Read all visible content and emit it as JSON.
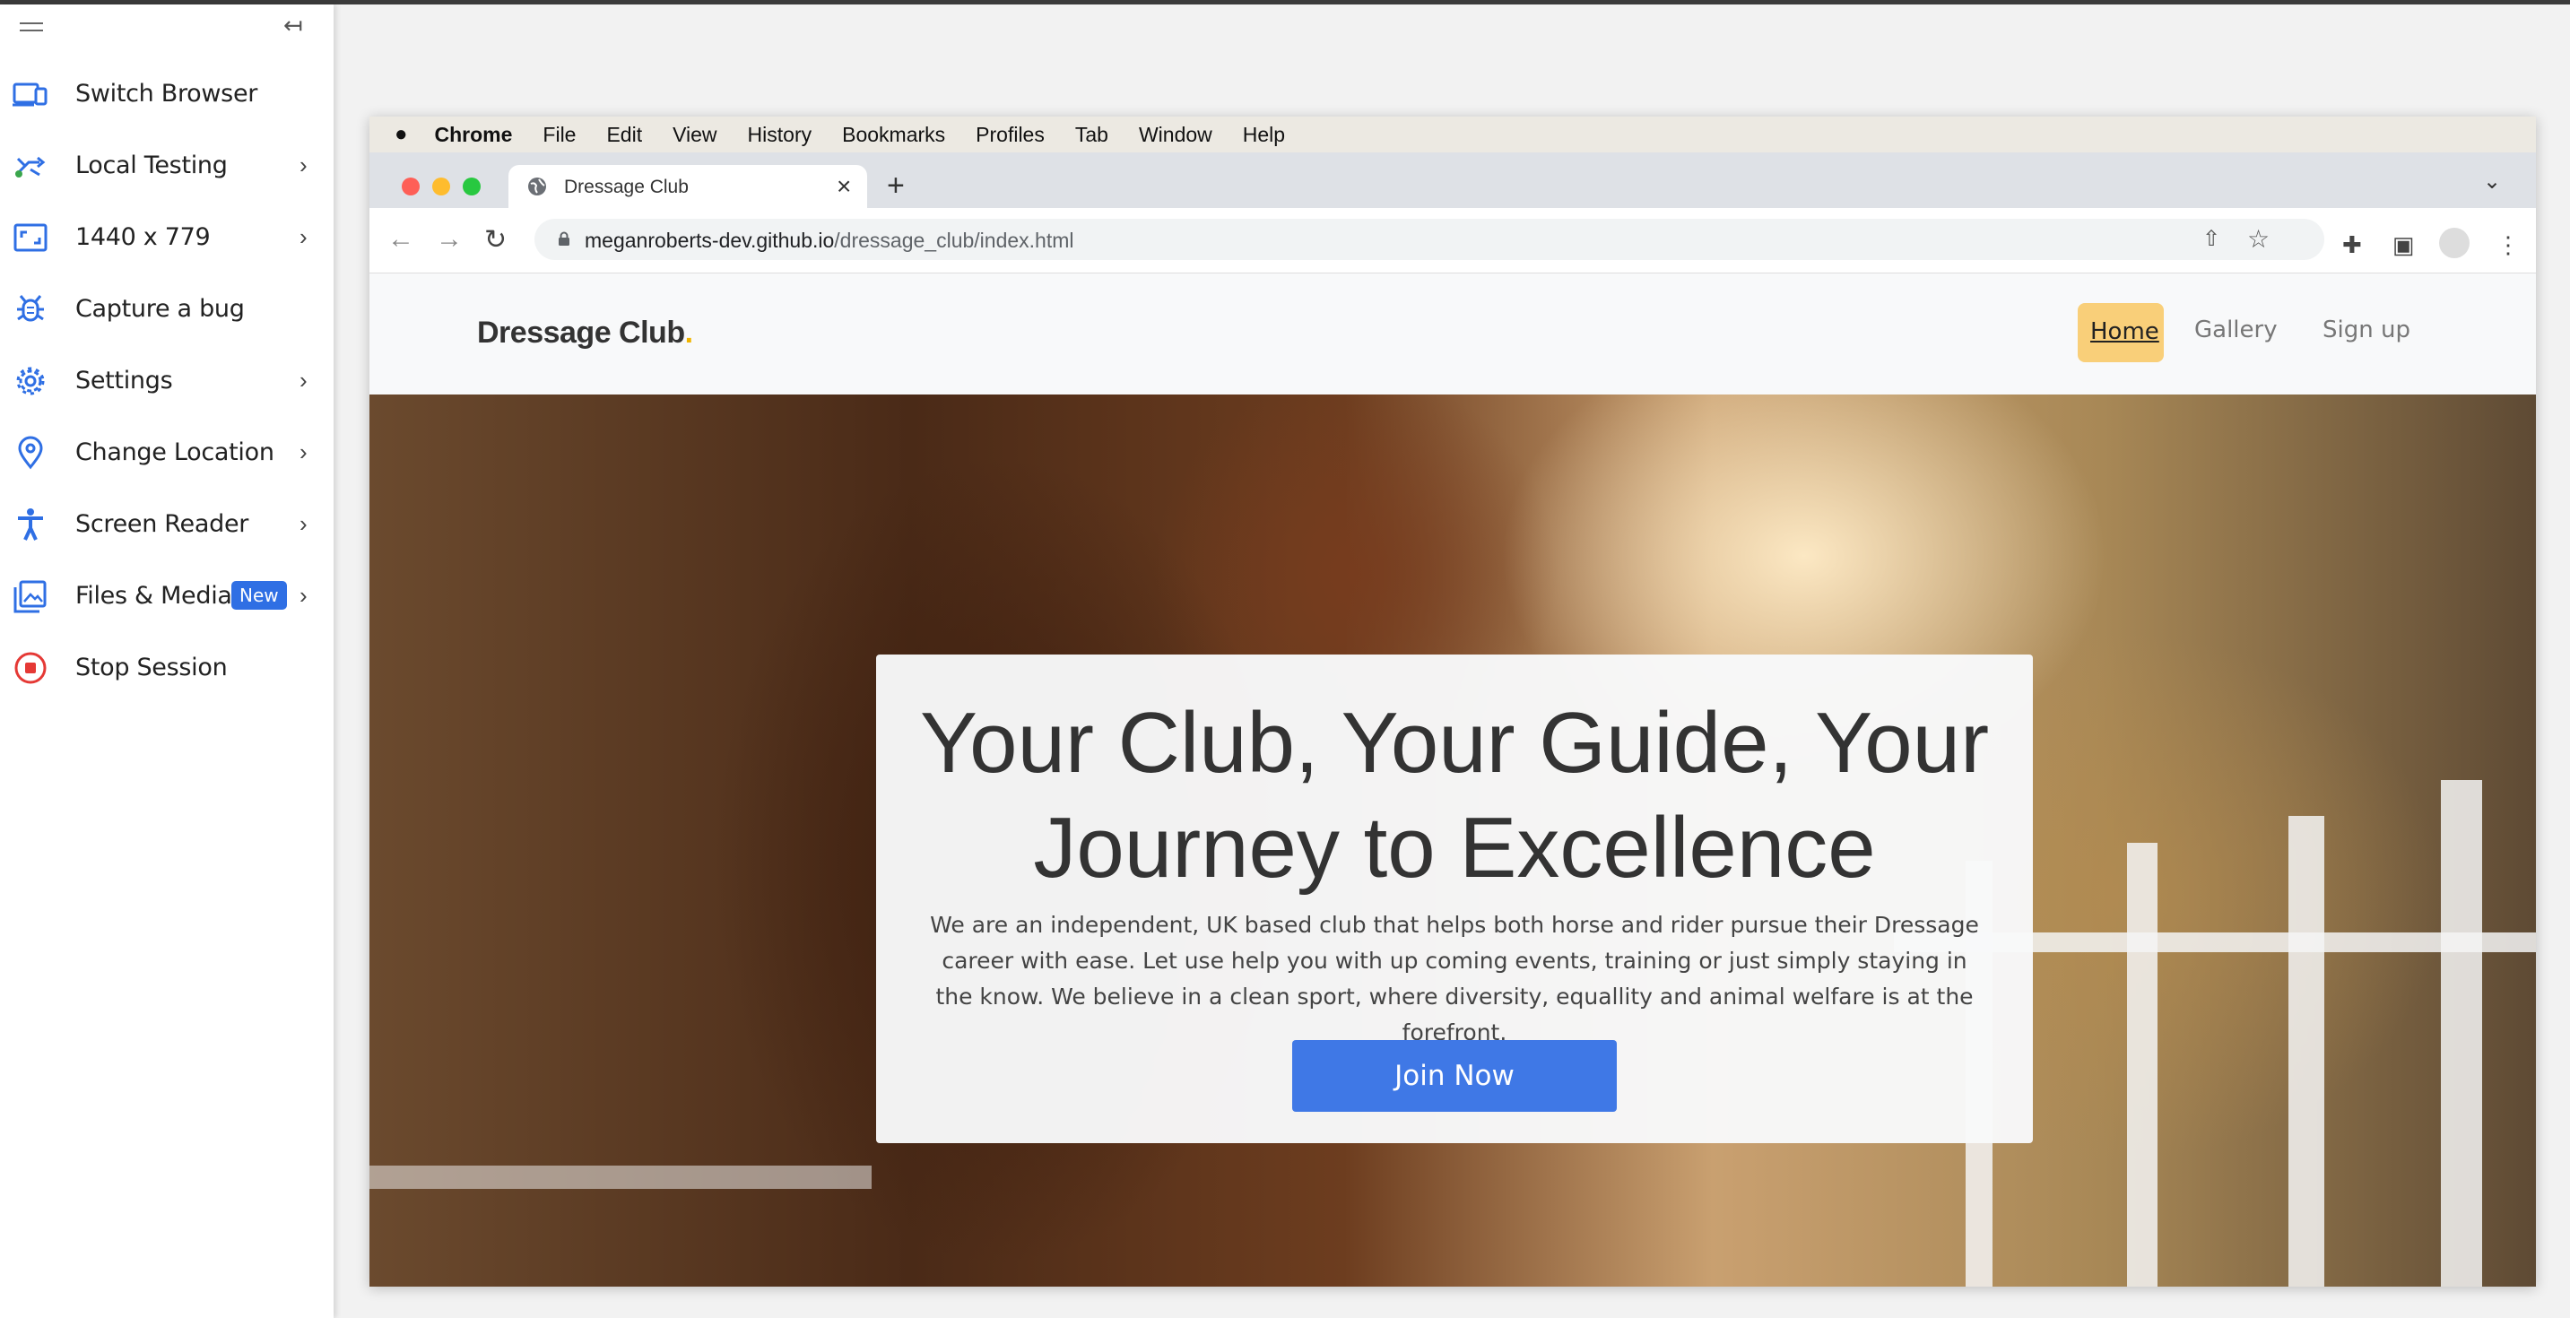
{
  "toolbar": {
    "items": [
      {
        "label": "Switch Browser",
        "icon": "devices-icon",
        "chevron": false
      },
      {
        "label": "Local Testing",
        "icon": "shuffle-icon",
        "chevron": true
      },
      {
        "label": "1440 x 779",
        "icon": "resolution-icon",
        "chevron": true
      },
      {
        "label": "Capture a bug",
        "icon": "bug-icon",
        "chevron": false
      },
      {
        "label": "Settings",
        "icon": "gear-icon",
        "chevron": true
      },
      {
        "label": "Change Location",
        "icon": "location-pin-icon",
        "chevron": true
      },
      {
        "label": "Screen Reader",
        "icon": "accessibility-icon",
        "chevron": true
      },
      {
        "label": "Files & Media",
        "icon": "image-files-icon",
        "chevron": true,
        "badge": "New"
      },
      {
        "label": "Stop Session",
        "icon": "stop-icon",
        "chevron": false
      }
    ],
    "accent_color": "#2f6fe4",
    "stop_color": "#e53935"
  },
  "mac_menu": {
    "apple": "",
    "app": "Chrome",
    "items": [
      "File",
      "Edit",
      "View",
      "History",
      "Bookmarks",
      "Profiles",
      "Tab",
      "Window",
      "Help"
    ]
  },
  "browser": {
    "tab_title": "Dressage Club",
    "url_host": "meganroberts-dev.github.io",
    "url_path": "/dressage_club/index.html"
  },
  "site": {
    "brand": "Dressage Club",
    "brand_dot": ".",
    "nav": {
      "home": "Home",
      "gallery": "Gallery",
      "signup": "Sign up"
    },
    "hero_title": "Your Club, Your Guide, Your Journey to Excellence",
    "hero_text": "We are an independent, UK based club that helps both horse and rider pursue their Dressage career with ease. Let use help you with up coming events, training or just simply staying in the know. We believe in a clean sport, where diversity, equallity and animal welfare is at the forefront.",
    "cta": "Join Now",
    "accent_color": "#f9cf79",
    "button_color": "#3f78e6"
  }
}
